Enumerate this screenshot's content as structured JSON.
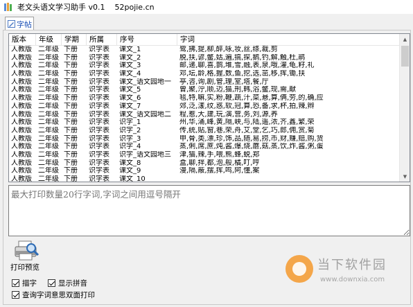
{
  "window": {
    "title": "老文头语文学习助手 v0.1    52pojie.cn"
  },
  "tabs": [
    {
      "label": "字帖"
    }
  ],
  "grid": {
    "columns": [
      "版本",
      "年级",
      "学期",
      "所属",
      "序号",
      "字词"
    ],
    "rows": [
      [
        "人教版",
        "二年级",
        "下册",
        "识字表",
        "课文_1",
        "鹭,拂,提,柳,醉,咏,妆,丝,绦,裁,剪"
      ],
      [
        "人教版",
        "二年级",
        "下册",
        "识字表",
        "课文_2",
        "脱,扶,谚,鳖,姑,遍,搞,探,鹅,钓,解,触,杜,鹃"
      ],
      [
        "人教版",
        "二年级",
        "下册",
        "识字表",
        "课文_3",
        "邮,递,聊,喜,鹊,堆,雪,融,表,泉,哦,灌,龟,籽,礼"
      ],
      [
        "人教版",
        "二年级",
        "下册",
        "识字表",
        "课文_4",
        "邓,坛,龄,格,握,数,鱼,挖,选,茁,移,挥,锄,扶"
      ],
      [
        "人教版",
        "二年级",
        "下册",
        "识字表",
        "课文_语文园地一",
        "亭,咨,询,剧,管,理,室,塔,餐,厅"
      ],
      [
        "人教版",
        "二年级",
        "下册",
        "识字表",
        "课文_5",
        "曾,聚,泞,顺,迈,猫,刑,韩,浴,鳖,现,需,献"
      ],
      [
        "人教版",
        "二年级",
        "下册",
        "识字表",
        "课文_6",
        "毯,特,嘛,实,粉,鞭,蔬,汁,菜,悬,算,俩,劳,的,确,应"
      ],
      [
        "人教版",
        "二年级",
        "下册",
        "识字表",
        "课文_7",
        "郊,泛,漾,纹,惑,软,冠,算,恐,备,求,杯,拍,辣,辫"
      ],
      [
        "人教版",
        "二年级",
        "下册",
        "识字表",
        "课文_语文园地二",
        "程,惹,大,建,玩,演,营,务,刘,源,养"
      ],
      [
        "人教版",
        "二年级",
        "下册",
        "识字表",
        "识字_1",
        "州,华,涌,峰,黄,隔,峡,与,陆,遥,浓,齐,鑫,繁,荣"
      ],
      [
        "人教版",
        "二年级",
        "下册",
        "识字表",
        "识字_2",
        "传,统,贴,窗,巷,荣,舟,艾,堂,乞,巧,郎,佣,赏,菊"
      ],
      [
        "人教版",
        "二年级",
        "下册",
        "识字表",
        "识字_3",
        "甲,骨,类,漂,珍,饰,品,随,易,捞,币,财,赚,赔,购,货"
      ],
      [
        "人教版",
        "二年级",
        "下册",
        "识字表",
        "识字_4",
        "蒸,俐,席,蔗,炖,酱,爆,烧,蘑,菇,蒸,饮,炸,酱,粥,蛋"
      ],
      [
        "人教版",
        "二年级",
        "下册",
        "识字表",
        "识字_语文园地三",
        "津,猫,辣,手,喂,熊,蜂,蜕,郑"
      ],
      [
        "人教版",
        "二年级",
        "下册",
        "识字表",
        "课文_8",
        "盒,聊,拌,都,泡,般,橘,叮,哼"
      ],
      [
        "人教版",
        "二年级",
        "下册",
        "识字表",
        "课文_9",
        "漫,隔,蔽,摆,挥,鸣,阿,懂,案"
      ],
      [
        "人教版",
        "二年级",
        "下册",
        "识字表",
        "课文_10",
        ""
      ]
    ]
  },
  "textarea": {
    "placeholder": "最大打印数量20行字词,字词之间用逗号隔开"
  },
  "print": {
    "label": "打印预览"
  },
  "options": [
    {
      "label": "描字",
      "checked": true
    },
    {
      "label": "显示拼音",
      "checked": true
    },
    {
      "label": "查询字词意思双面打印",
      "checked": true
    }
  ],
  "watermark": {
    "title": "当下软件园",
    "url": "www.downxia.com"
  },
  "colors": {
    "tab_text": "#1a4fb5",
    "logo": "#f4a64a"
  }
}
